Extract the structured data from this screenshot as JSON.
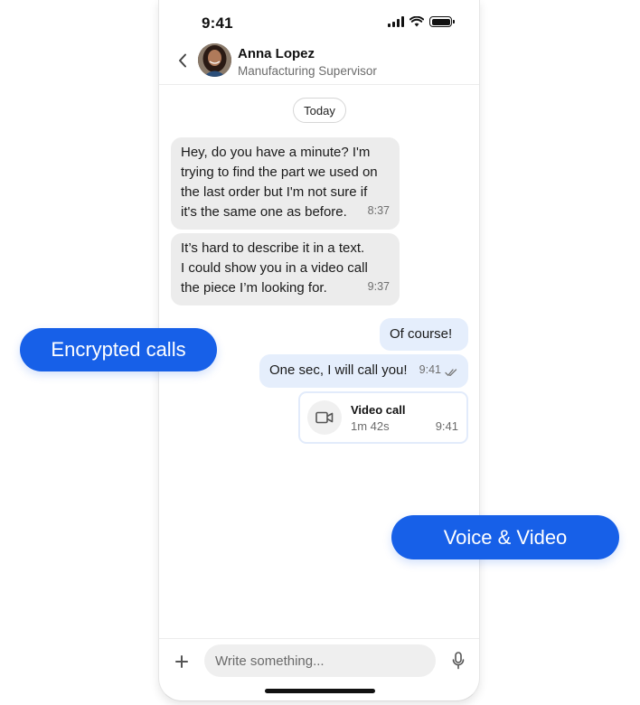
{
  "status_bar": {
    "time": "9:41",
    "icons": [
      "signal-icon",
      "wifi-icon",
      "battery-icon"
    ]
  },
  "contact": {
    "name": "Anna Lopez",
    "role": "Manufacturing Supervisor",
    "avatar_icon": "avatar-photo"
  },
  "chat": {
    "date_label": "Today",
    "messages": [
      {
        "direction": "incoming",
        "lines": [
          "Hey, do you have a minute? I'm",
          "trying to find the part we used on",
          "the last order but I'm not sure if",
          "it's the same one as before."
        ],
        "time": "8:37"
      },
      {
        "direction": "incoming",
        "lines": [
          "It’s hard to describe it in a text.",
          "I could show you in a video call",
          "the piece I’m looking for."
        ],
        "time": "9:37"
      },
      {
        "direction": "outgoing",
        "text": "Of course!"
      },
      {
        "direction": "outgoing",
        "text": "One sec, I will call you!",
        "time": "9:41",
        "status_icon": "double-check-icon"
      }
    ],
    "call": {
      "title": "Video call",
      "duration": "1m 42s",
      "time": "9:41",
      "icon": "video-camera-icon"
    }
  },
  "composer": {
    "placeholder": "Write something...",
    "value": "",
    "add_icon": "plus-icon",
    "mic_icon": "microphone-icon"
  },
  "feature_tags": {
    "encrypted": "Encrypted calls",
    "voice_video": "Voice & Video"
  },
  "colors": {
    "accent": "#1760e8",
    "incoming_bubble": "#ececec",
    "outgoing_bubble": "#e5eefc"
  }
}
